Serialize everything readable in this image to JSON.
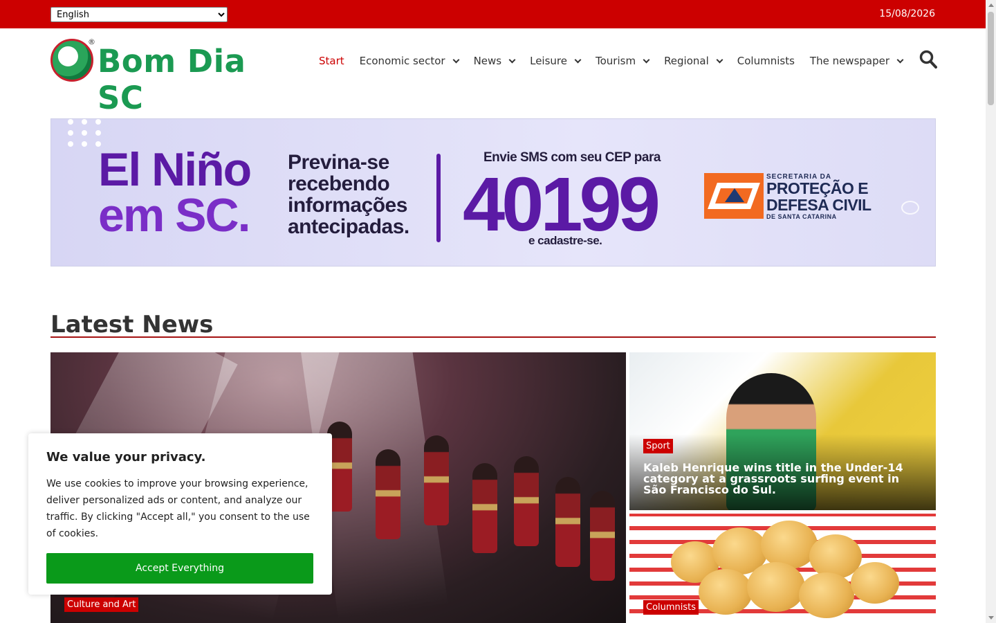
{
  "topbar": {
    "language_selected": "English",
    "date": "15/08/2026"
  },
  "header": {
    "logo_text": "Bom Dia SC",
    "logo_reg": "®",
    "nav": [
      {
        "label": "Start",
        "active": true,
        "dropdown": false
      },
      {
        "label": "Economic sector",
        "active": false,
        "dropdown": true
      },
      {
        "label": "News",
        "active": false,
        "dropdown": true
      },
      {
        "label": "Leisure",
        "active": false,
        "dropdown": true
      },
      {
        "label": "Tourism",
        "active": false,
        "dropdown": true
      },
      {
        "label": "Regional",
        "active": false,
        "dropdown": true
      },
      {
        "label": "Columnists",
        "active": false,
        "dropdown": false
      },
      {
        "label": "The newspaper",
        "active": false,
        "dropdown": true
      }
    ],
    "search_icon": "search-icon"
  },
  "banner": {
    "headline_1": "El Niño",
    "headline_2": "em SC.",
    "sub_1": "Previna-se",
    "sub_2": "recebendo",
    "sub_3": "informações",
    "sub_4": "antecipadas.",
    "sms_text": "Envie SMS com seu CEP para",
    "number": "40199",
    "cadastre": "e cadastre-se.",
    "org_small": "SECRETARIA DA",
    "org_big_1": "PROTEÇÃO E",
    "org_big_2": "DEFESA CIVIL",
    "org_sc": "DE SANTA CATARINA"
  },
  "latest": {
    "title": "Latest News",
    "main": {
      "tag": "Culture and Art"
    },
    "side1": {
      "tag": "Sport",
      "title": "Kaleb Henrique wins title in the Under-14 category at a grassroots surfing event in São Francisco do Sul."
    },
    "side2": {
      "tag": "Columnists"
    }
  },
  "cookie": {
    "title": "We value your privacy.",
    "text": "We use cookies to improve your browsing experience, deliver personalized ads or content, and analyze our traffic. By clicking \"Accept all,\" you consent to the use of cookies.",
    "button": "Accept Everything"
  },
  "colors": {
    "brand_red": "#cc0000",
    "brand_green": "#1b9a52",
    "accept_green": "#0a9a1a"
  }
}
